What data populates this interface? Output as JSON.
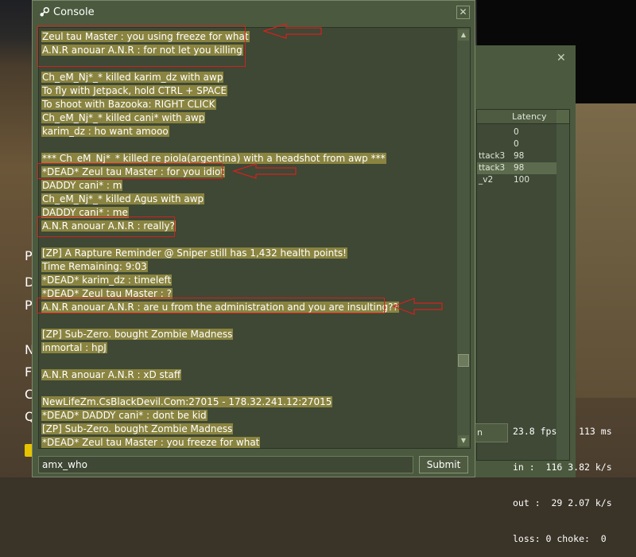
{
  "window": {
    "title": "Console",
    "close_symbol": "✕"
  },
  "log_lines": [
    {
      "text": "Zeul tau Master :  you using freeze for what",
      "hl": true
    },
    {
      "text": "A.N.R anouar A.N.R :  for not let you killing",
      "hl": true
    },
    {
      "text": "",
      "hl": false
    },
    {
      "text": "Ch_eM_Nj*_* killed karim_dz with awp",
      "hl": true
    },
    {
      "text": "To fly with Jetpack, hold CTRL + SPACE",
      "hl": true
    },
    {
      "text": "To shoot with Bazooka: RIGHT CLICK",
      "hl": true
    },
    {
      "text": "Ch_eM_Nj*_* killed cani* with awp",
      "hl": true
    },
    {
      "text": "karim_dz :  ho want amooo",
      "hl": true
    },
    {
      "text": "",
      "hl": false
    },
    {
      "text": "*** Ch_eM_Nj*_* killed re piola(argentina) with a headshot from awp ***",
      "hl": true
    },
    {
      "text": "*DEAD* Zeul tau Master :  for you idiot",
      "hl": true
    },
    {
      "text": "DADDY cani* :  m",
      "hl": true
    },
    {
      "text": "Ch_eM_Nj*_* killed Agus with awp",
      "hl": true
    },
    {
      "text": "DADDY cani* :  me",
      "hl": true
    },
    {
      "text": "A.N.R anouar A.N.R :  really?",
      "hl": true
    },
    {
      "text": "",
      "hl": false
    },
    {
      "text": "[ZP] A Rapture Reminder @ Sniper still has 1,432 health points!",
      "hl": true
    },
    {
      "text": "Time Remaining: 9:03",
      "hl": true
    },
    {
      "text": "*DEAD* karim_dz :  timeleft",
      "hl": true
    },
    {
      "text": "*DEAD* Zeul tau Master :  ?",
      "hl": true
    },
    {
      "text": "A.N.R anouar A.N.R :  are u from the administration and you are insulting??",
      "hl": true
    },
    {
      "text": "",
      "hl": false
    },
    {
      "text": "[ZP] Sub-Zero. bought Zombie Madness",
      "hl": true
    },
    {
      "text": "inmortal :  hpJ",
      "hl": true
    },
    {
      "text": "",
      "hl": false
    },
    {
      "text": "A.N.R anouar A.N.R :  xD staff",
      "hl": true
    },
    {
      "text": "",
      "hl": false
    },
    {
      "text": "NewLifeZm.CsBlackDevil.Com:27015 - 178.32.241.12:27015",
      "hl": true
    },
    {
      "text": "*DEAD* DADDY cani* :  dont be kid",
      "hl": true
    },
    {
      "text": "[ZP] Sub-Zero. bought Zombie Madness",
      "hl": true
    },
    {
      "text": "*DEAD* Zeul tau Master :  you freeze for what",
      "hl": true
    }
  ],
  "input": {
    "value": "amx_who"
  },
  "submit_label": "Submit",
  "server_list": {
    "close_symbol": "✕",
    "column_latency": "Latency",
    "rows": [
      {
        "name": "",
        "latency": "0",
        "sel": false
      },
      {
        "name": "",
        "latency": "0",
        "sel": false
      },
      {
        "name": "ttack3",
        "latency": "98",
        "sel": false
      },
      {
        "name": "ttack3",
        "latency": "98",
        "sel": true
      },
      {
        "name": "_v2",
        "latency": "100",
        "sel": false
      }
    ],
    "button_label": "n"
  },
  "side_letters": [
    "P",
    "D",
    "P",
    "N",
    "F",
    "C",
    "Q"
  ],
  "netgraph": {
    "line1": "23.8 fps    113 ms",
    "line2": "in :  116 3.82 k/s",
    "line3": "out :  29 2.07 k/s",
    "line4": "loss: 0 choke:  0"
  },
  "colors": {
    "accent_highlight": "#8a8440",
    "window_bg": "#4b5a3e",
    "annotation_red": "#d42020"
  }
}
